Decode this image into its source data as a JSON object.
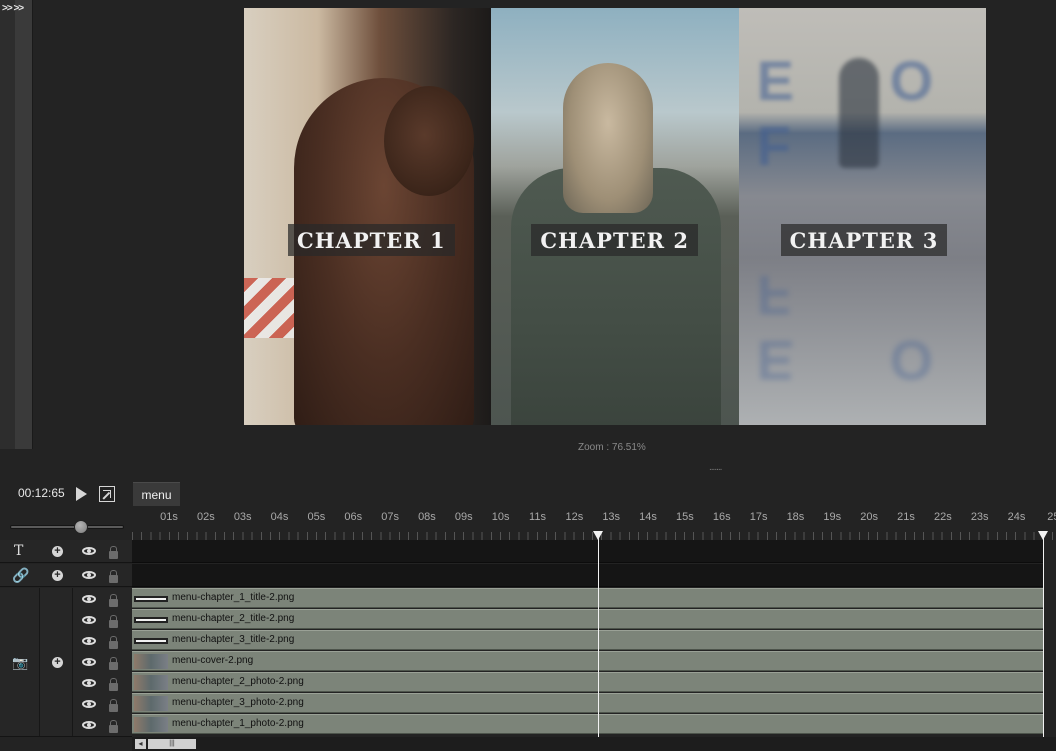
{
  "side_panel": {
    "expand_label": ">> >>"
  },
  "preview": {
    "chapters": [
      "CHAPTER 1",
      "CHAPTER 2",
      "CHAPTER 3"
    ],
    "zoom_text": "Zoom : 76.51%",
    "grip": "......."
  },
  "transport": {
    "timecode": "00:12:65",
    "play_icon": "play-icon",
    "popout_icon": "popout-icon",
    "active_tab": "menu"
  },
  "ruler": {
    "ticks": [
      "01s",
      "02s",
      "03s",
      "04s",
      "05s",
      "06s",
      "07s",
      "08s",
      "09s",
      "10s",
      "11s",
      "12s",
      "13s",
      "14s",
      "15s",
      "16s",
      "17s",
      "18s",
      "19s",
      "20s",
      "21s",
      "22s",
      "23s",
      "24s",
      "25"
    ]
  },
  "tracks": {
    "text_track_icon": "T",
    "link_track_icon": "link-icon",
    "image_track_icon": "camera-icon",
    "clips": [
      {
        "name": "menu-chapter_1_title-2.png",
        "thumb": "title"
      },
      {
        "name": "menu-chapter_2_title-2.png",
        "thumb": "title"
      },
      {
        "name": "menu-chapter_3_title-2.png",
        "thumb": "title"
      },
      {
        "name": "menu-cover-2.png",
        "thumb": "photo"
      },
      {
        "name": "menu-chapter_2_photo-2.png",
        "thumb": "photo"
      },
      {
        "name": "menu-chapter_3_photo-2.png",
        "thumb": "photo"
      },
      {
        "name": "menu-chapter_1_photo-2.png",
        "thumb": "photo"
      }
    ]
  },
  "scrollbar": {
    "left_arrow": "◂",
    "thumb_grip": "|||"
  },
  "colors": {
    "background": "#232323",
    "clip": "#7c8479",
    "playhead": "#f2f2f2"
  }
}
